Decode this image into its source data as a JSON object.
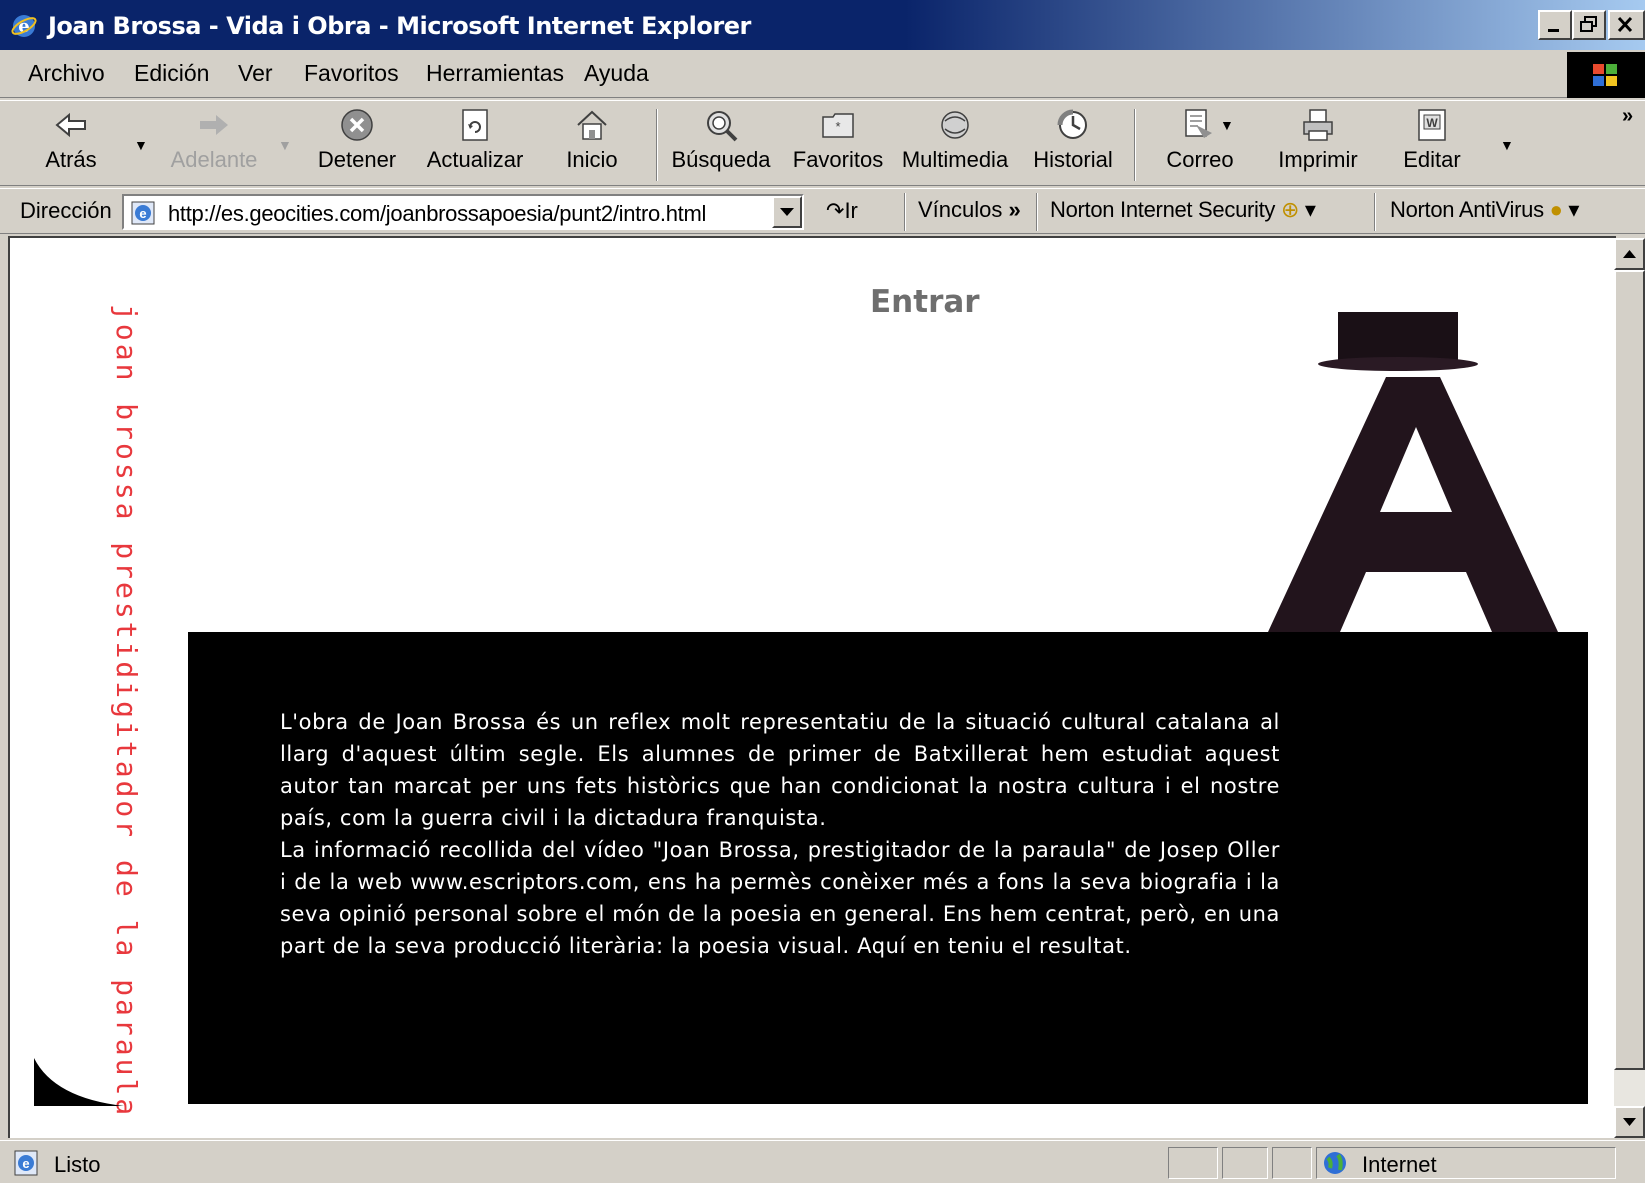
{
  "window": {
    "title": "Joan Brossa - Vida i Obra - Microsoft Internet Explorer"
  },
  "menu": {
    "items": [
      {
        "label": "Archivo"
      },
      {
        "label": "Edición"
      },
      {
        "label": "Ver"
      },
      {
        "label": "Favoritos"
      },
      {
        "label": "Herramientas"
      },
      {
        "label": "Ayuda"
      }
    ]
  },
  "toolbar": {
    "back": "Atrás",
    "forward": "Adelante",
    "stop": "Detener",
    "refresh": "Actualizar",
    "home": "Inicio",
    "search": "Búsqueda",
    "favorites": "Favoritos",
    "media": "Multimedia",
    "history": "Historial",
    "mail": "Correo",
    "print": "Imprimir",
    "edit": "Editar"
  },
  "address": {
    "label": "Dirección",
    "url": "http://es.geocities.com/joanbrossapoesia/punt2/intro.html",
    "go": "Ir",
    "links": "Vínculos",
    "norton_security": "Norton Internet Security",
    "norton_antivirus": "Norton AntiVirus"
  },
  "page": {
    "vertical_title": "joan brossa prestidigitador de la paraula",
    "enter_link": "Entrar",
    "paragraph_1": "L'obra de Joan Brossa és un reflex molt representatiu de la situació cultural catalana al llarg d'aquest últim segle. Els alumnes de primer de Batxillerat hem estudiat aquest autor tan marcat per uns fets històrics que han condicionat la nostra cultura i el nostre país, com la guerra civil i la dictadura franquista.",
    "paragraph_2": "La informació recollida del vídeo \"Joan Brossa, prestigitador de la paraula\" de Josep Oller i de la web www.escriptors.com, ens ha permès conèixer més a fons la seva biografia i la seva opinió personal sobre el món de la poesia en general. Ens hem centrat, però, en una part de la seva producció literària: la poesia visual. Aquí en teniu el resultat."
  },
  "status": {
    "text": "Listo",
    "zone": "Internet"
  },
  "colors": {
    "title_bar": "#0a246a",
    "vertical_title": "#e8383d",
    "enter_link": "#6e6e6e",
    "panel": "#000000"
  }
}
